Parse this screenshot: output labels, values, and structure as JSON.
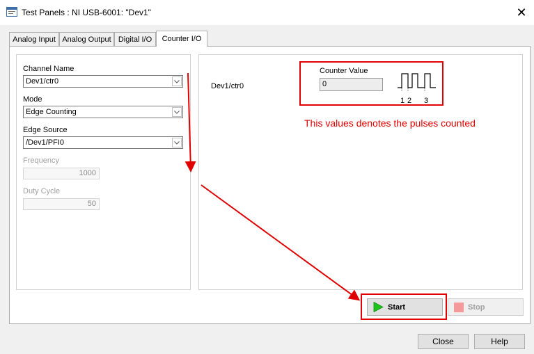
{
  "window": {
    "title": "Test Panels : NI USB-6001: \"Dev1\""
  },
  "tabs": [
    {
      "label": "Analog Input"
    },
    {
      "label": "Analog Output"
    },
    {
      "label": "Digital I/O"
    },
    {
      "label": "Counter I/O",
      "active": true
    }
  ],
  "settings": {
    "channel_name": {
      "label": "Channel Name",
      "value": "Dev1/ctr0"
    },
    "mode": {
      "label": "Mode",
      "value": "Edge Counting"
    },
    "edge_source": {
      "label": "Edge Source",
      "value": "/Dev1/PFI0"
    },
    "frequency": {
      "label": "Frequency",
      "value": "1000"
    },
    "duty_cycle": {
      "label": "Duty Cycle",
      "value": "50"
    }
  },
  "display": {
    "channel": "Dev1/ctr0",
    "counter_value_label": "Counter Value",
    "counter_value": "0",
    "pulse_labels": [
      "1",
      "2",
      "3"
    ]
  },
  "annotation": {
    "text": "This values denotes the pulses counted",
    "color": "#e00000"
  },
  "buttons": {
    "start": "Start",
    "stop": "Stop",
    "close": "Close",
    "help": "Help"
  }
}
